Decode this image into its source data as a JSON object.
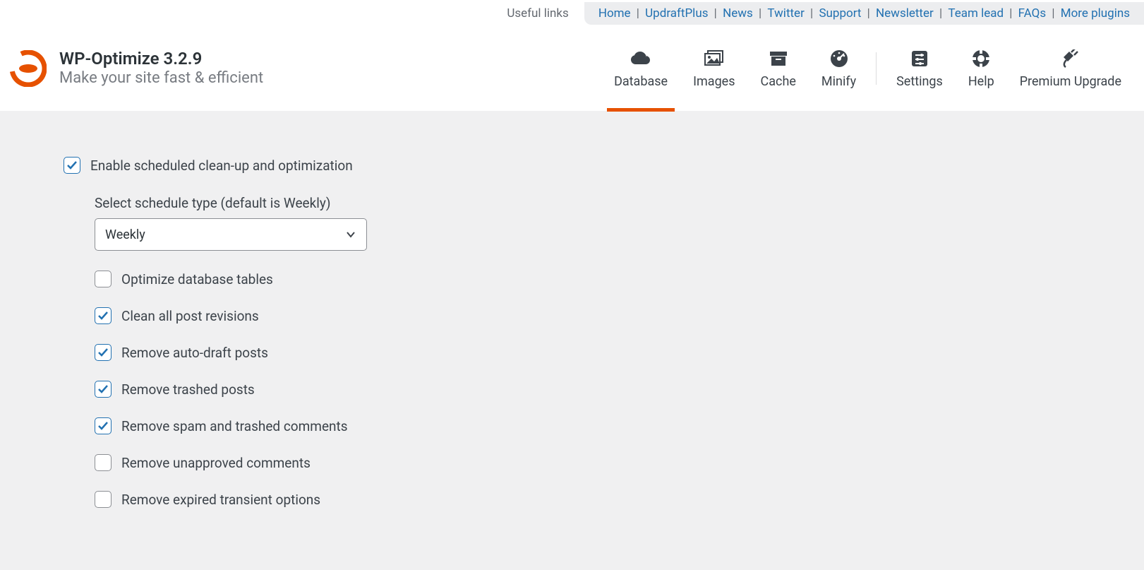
{
  "topbar": {
    "useful_links_label": "Useful links",
    "links": [
      "Home",
      "UpdraftPlus",
      "News",
      "Twitter",
      "Support",
      "Newsletter",
      "Team lead",
      "FAQs",
      "More plugins"
    ]
  },
  "brand": {
    "title": "WP-Optimize 3.2.9",
    "subtitle": "Make your site fast & efficient"
  },
  "tabs": {
    "items": [
      {
        "id": "database",
        "label": "Database",
        "icon": "cloud-icon",
        "active": true
      },
      {
        "id": "images",
        "label": "Images",
        "icon": "images-icon"
      },
      {
        "id": "cache",
        "label": "Cache",
        "icon": "archive-icon"
      },
      {
        "id": "minify",
        "label": "Minify",
        "icon": "gauge-icon"
      }
    ],
    "right_items": [
      {
        "id": "settings",
        "label": "Settings",
        "icon": "sliders-icon"
      },
      {
        "id": "help",
        "label": "Help",
        "icon": "lifebuoy-icon"
      },
      {
        "id": "premium",
        "label": "Premium Upgrade",
        "icon": "plug-icon"
      }
    ]
  },
  "panel": {
    "enable_label": "Enable scheduled clean-up and optimization",
    "enable_checked": true,
    "schedule_label": "Select schedule type (default is Weekly)",
    "schedule_value": "Weekly",
    "options": [
      {
        "label": "Optimize database tables",
        "checked": false
      },
      {
        "label": "Clean all post revisions",
        "checked": true
      },
      {
        "label": "Remove auto-draft posts",
        "checked": true
      },
      {
        "label": "Remove trashed posts",
        "checked": true
      },
      {
        "label": "Remove spam and trashed comments",
        "checked": true
      },
      {
        "label": "Remove unapproved comments",
        "checked": false
      },
      {
        "label": "Remove expired transient options",
        "checked": false
      }
    ]
  }
}
